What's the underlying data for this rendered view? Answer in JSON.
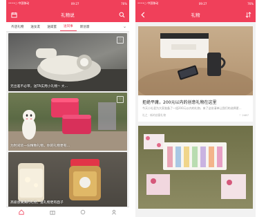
{
  "left": {
    "status": {
      "carrier": "••••○ 中国移动 ",
      "time": "09:27",
      "battery": "76%"
    },
    "title": "礼物说",
    "tabs": [
      "齐店礼物",
      "送女友",
      "送闺蜜",
      "送同事",
      "新创意"
    ],
    "active_tab_index": 3,
    "cards": [
      {
        "caption": "无出差不必带，送TA实用小礼物~ 大..."
      },
      {
        "caption": "为时间装一份精致礼物，你的礼物更有..."
      },
      {
        "caption": "高级感满满的礼物，送礼物更有面子"
      }
    ]
  },
  "right": {
    "status": {
      "carrier": "••••○ 中国移动 ",
      "time": "09:27",
      "battery": "76%"
    },
    "title": "礼物",
    "article": {
      "title": "拒绝平庸，200元以内的创意礼物在这里",
      "desc": "今天小礼君为大家准备了一组200元以内的礼物，来了这份清单让我们的选择更…",
      "source": "礼之 · 新的创意礼物",
      "likes": "♡ 2487"
    }
  },
  "colors": {
    "accent": "#f0405a"
  },
  "icons": {
    "left_nav_left": "calendar-icon",
    "left_nav_right": "search-icon",
    "right_nav_left": "back-icon",
    "right_nav_right": "sort-icon",
    "bottom_nav": [
      "home-icon",
      "gift-icon",
      "category-icon",
      "profile-icon"
    ]
  }
}
